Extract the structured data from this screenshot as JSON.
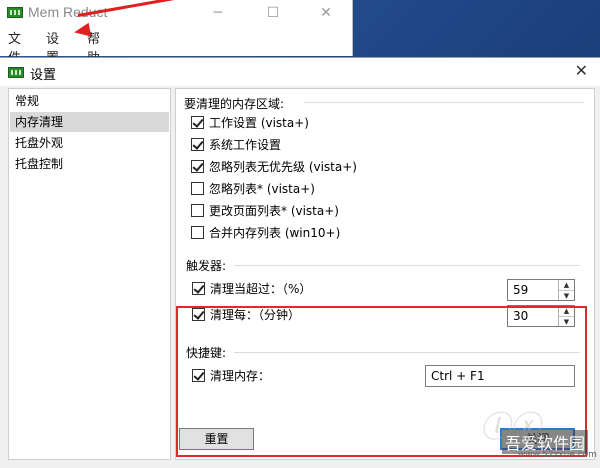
{
  "main_window": {
    "title": "Mem Reduct",
    "minimize": "─",
    "maximize": "☐",
    "close": "✕",
    "menu": [
      "文件",
      "设置",
      "帮助"
    ]
  },
  "dialog": {
    "title": "设置",
    "close": "✕"
  },
  "sidebar": {
    "items": [
      {
        "label": "常规",
        "selected": false
      },
      {
        "label": "内存清理",
        "selected": true
      },
      {
        "label": "托盘外观",
        "selected": false
      },
      {
        "label": "托盘控制",
        "selected": false
      }
    ]
  },
  "memory_areas": {
    "heading": "要清理的内存区域:",
    "options": [
      {
        "label": "工作设置 (vista+)",
        "checked": true
      },
      {
        "label": "系统工作设置",
        "checked": true
      },
      {
        "label": "忽略列表无优先级 (vista+)",
        "checked": true
      },
      {
        "label": "忽略列表* (vista+)",
        "checked": false
      },
      {
        "label": "更改页面列表* (vista+)",
        "checked": false
      },
      {
        "label": "合并内存列表 (win10+)",
        "checked": false
      }
    ]
  },
  "trigger": {
    "heading": "触发器:",
    "threshold_label": "清理当超过：（%）",
    "threshold_value": "59",
    "interval_label": "清理每：（分钟）",
    "interval_value": "30"
  },
  "hotkey": {
    "heading": "快捷键:",
    "label": "清理内存：",
    "value": "Ctrl + F1"
  },
  "buttons": {
    "reset": "重置",
    "apply": "关闭"
  },
  "watermark": {
    "badge": "吾爱软件园",
    "url": "www.52zxue.com"
  },
  "colors": {
    "annotation_red": "#e02020",
    "accent_blue": "#2a78d4"
  }
}
